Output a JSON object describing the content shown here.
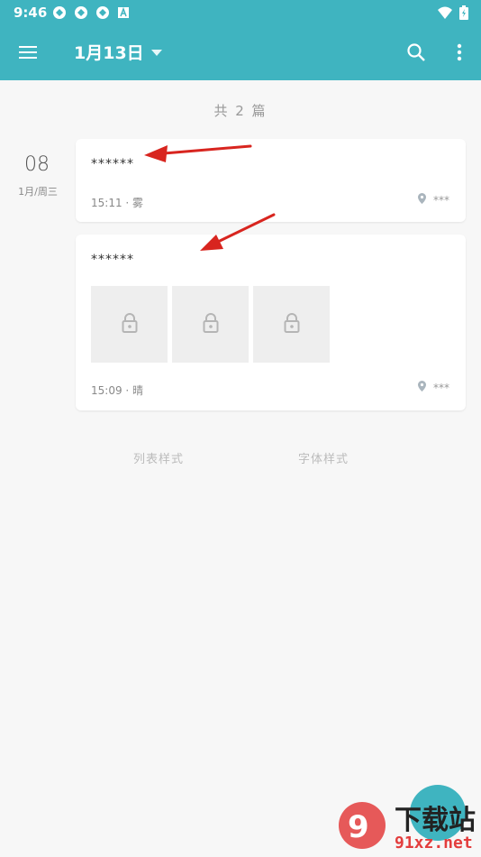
{
  "status": {
    "time": "9:46"
  },
  "toolbar": {
    "title": "1月13日"
  },
  "list": {
    "count": "共 2 篇"
  },
  "date_group": {
    "day": "08",
    "sub": "1月/周三"
  },
  "notes": [
    {
      "title": "******",
      "meta": "15:11 · 雾",
      "location": "***"
    },
    {
      "title": "******",
      "meta": "15:09 · 晴",
      "location": "***"
    }
  ],
  "options": {
    "list_style": "列表样式",
    "font_style": "字体样式"
  },
  "watermark": {
    "text_main": "下载站",
    "text_sub": "91xz.net"
  },
  "colors": {
    "accent": "#3fb4c0",
    "arrow": "#e02020"
  }
}
